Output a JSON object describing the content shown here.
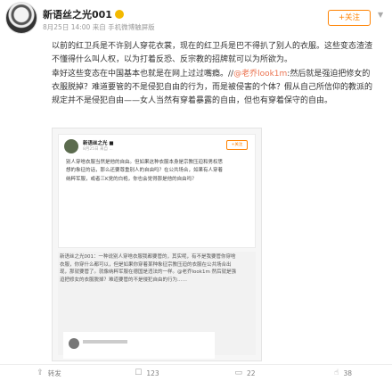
{
  "header": {
    "username": "新语丝之光001",
    "meta": "8月25日 14:00 来自 手机微博触屏版",
    "follow_label": "+关注"
  },
  "post": {
    "paragraphs": [
      "以前的红卫兵是不许别人穿花衣裳，现在的红卫兵是巴不得扒了别人的衣服。这些变态渣渣不懂得什么叫人权，以为打着反恐、反宗教的招牌就可以为所欲为。",
      "幸好这些变态在中国基本也就是在网上过过嘴瘾。//"
    ],
    "mention": "@老乔look1m",
    "mention_text": ":然后就是强迫把修女的衣服脱掉？难道要管的不是侵犯自由的行为，而是被侵害的个体？假从自己所信仰的教派的规定并不是侵犯自由——女人当然有穿着暴露的自由，但也有穿着保守的自由。"
  },
  "embedded": {
    "card1": {
      "name": "新语丝之光 ■",
      "meta": "8月25日 来自 ...",
      "follow": "+关注",
      "text": "别人穿啥衣服当然是他的自由。但如果这种衣服本身是宗教压迫和男权思想的象征的话，那么还要尊重别人的自由吗？在公共场合，如果有人穿着纳粹军服，或者三K党的白袍，你也会觉得那是他的自由吗？"
    },
    "card2": {
      "text": "新语丝之光001：一种说别人穿啥衣服我都要管的，其实呢，有不是我要管你穿啥衣服，你穿什么都可以，但是如果你穿着某种象征宗教压迫的衣服在公共场合出现，那就要管了。就像纳粹军服在德国是违法的一样。@老乔look1m 然后就是强迫把修女的衣服脱掉？难道要管的不是侵犯自由的行为……"
    }
  },
  "footer": {
    "share_label": "转发",
    "comment_label": "123",
    "repost_label": "22",
    "like_label": "38"
  }
}
